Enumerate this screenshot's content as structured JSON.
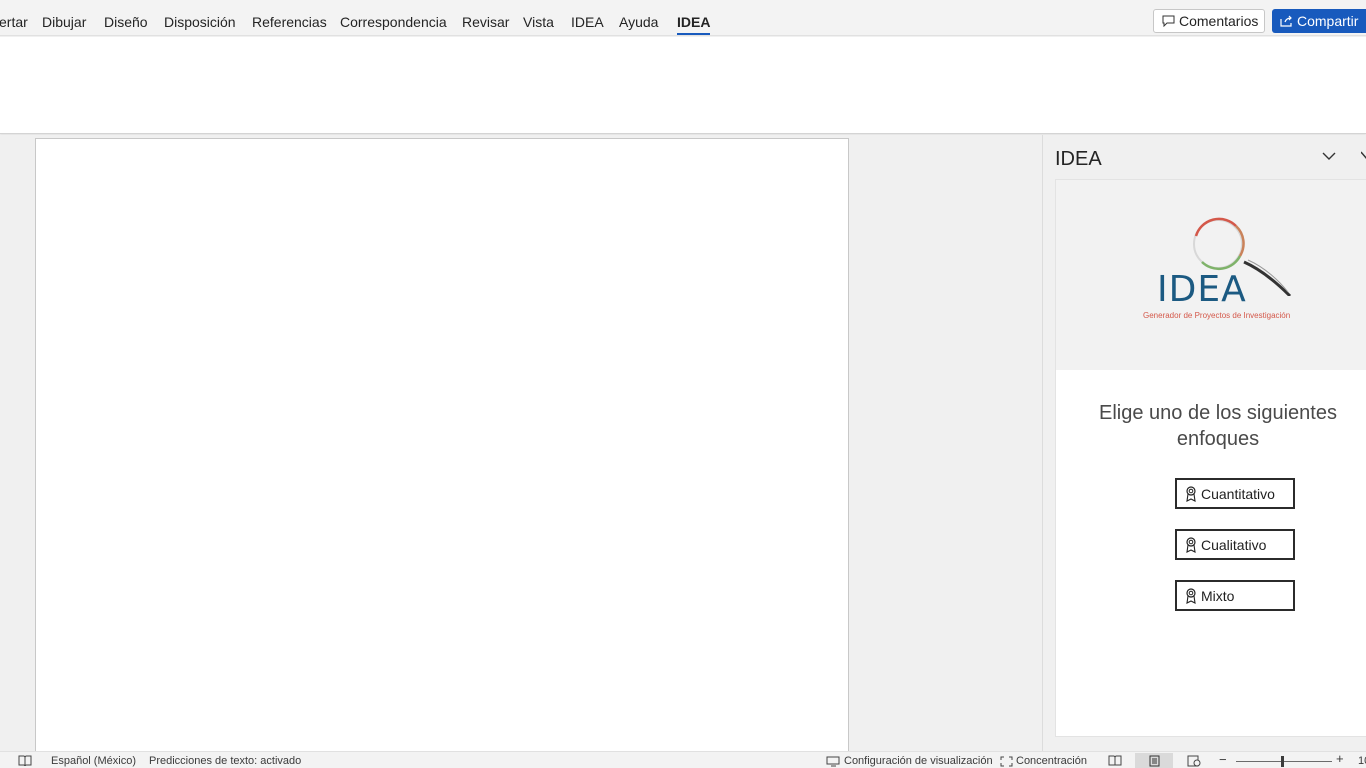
{
  "ribbon": {
    "tabs": [
      {
        "label": "ertar",
        "active": false
      },
      {
        "label": "Dibujar",
        "active": false
      },
      {
        "label": "Diseño",
        "active": false
      },
      {
        "label": "Disposición",
        "active": false
      },
      {
        "label": "Referencias",
        "active": false
      },
      {
        "label": "Correspondencia",
        "active": false
      },
      {
        "label": "Revisar",
        "active": false
      },
      {
        "label": "Vista",
        "active": false
      },
      {
        "label": "IDEA",
        "active": false
      },
      {
        "label": "Ayuda",
        "active": false
      },
      {
        "label": "IDEA",
        "active": true
      }
    ],
    "comments_label": "Comentarios",
    "share_label": "Compartir",
    "accent_color": "#185abd"
  },
  "taskpane": {
    "title": "IDEA",
    "logo": {
      "wordmark": "IDEA",
      "tagline": "Generador de Proyectos de Investigación"
    },
    "prompt": "Elige uno de los siguientes enfoques",
    "choices": [
      {
        "label": "Cuantitativo",
        "icon": "ribbon-award-icon"
      },
      {
        "label": "Cualitativo",
        "icon": "ribbon-award-icon"
      },
      {
        "label": "Mixto",
        "icon": "ribbon-award-icon"
      }
    ]
  },
  "statusbar": {
    "language": "Español (México)",
    "text_predictions": "Predicciones de texto: activado",
    "display_settings": "Configuración de visualización",
    "focus": "Concentración",
    "zoom_text": "10"
  }
}
